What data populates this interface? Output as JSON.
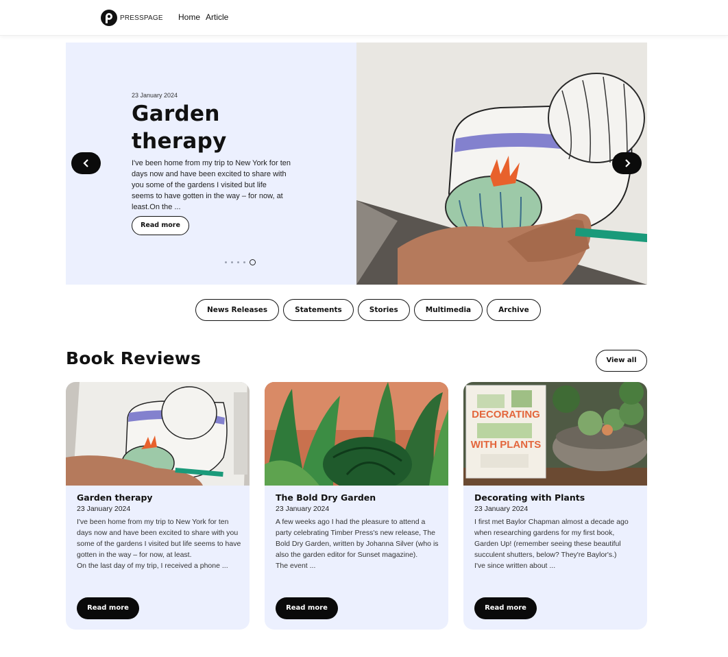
{
  "header": {
    "logo_text": "PRESSPAGE",
    "nav": [
      "Home",
      "Article"
    ]
  },
  "hero": {
    "date": "23 January 2024",
    "title": "Garden therapy",
    "body": "I've been home from my trip to New York for ten days now and have been excited to share with you some of the gardens I visited but life seems to have gotten in the way – for now, at least.On the ...",
    "read_more": "Read more",
    "slide_count": 5,
    "active_slide": 5
  },
  "categories": [
    "News Releases",
    "Statements",
    "Stories",
    "Multimedia",
    "Archive"
  ],
  "section": {
    "title": "Book Reviews",
    "view_all": "View all"
  },
  "cards": [
    {
      "title": "Garden therapy",
      "date": "23 January 2024",
      "text": "I've been home from my trip to New York for ten days now and have been excited to share with you some of the gardens I visited but life seems to have gotten in the way – for now, at least.\nOn the last day of my trip, I received a phone ...",
      "button": "Read more"
    },
    {
      "title": "The Bold Dry Garden",
      "date": "23 January 2024",
      "text": "A few weeks ago I had the pleasure to attend a party celebrating Timber Press's new release, The Bold Dry Garden, written by Johanna Silver (who is also the garden editor for Sunset magazine).\nThe event ...",
      "button": "Read more"
    },
    {
      "title": "Decorating with Plants",
      "date": "23 January 2024",
      "text": "I first met Baylor Chapman almost a decade ago when researching gardens for my first book, Garden Up!  (remember seeing these beautiful succulent shutters, below?  They're Baylor's.)\nI've since written about ...",
      "button": "Read more"
    }
  ],
  "images": {
    "book_cover_title_line1": "DECORATING",
    "book_cover_title_line2": "WITH PLANTS"
  },
  "colors": {
    "panel_bg": "#ecf0fe",
    "button_dark": "#0a0a0a",
    "accent_orange": "#e8612c"
  }
}
